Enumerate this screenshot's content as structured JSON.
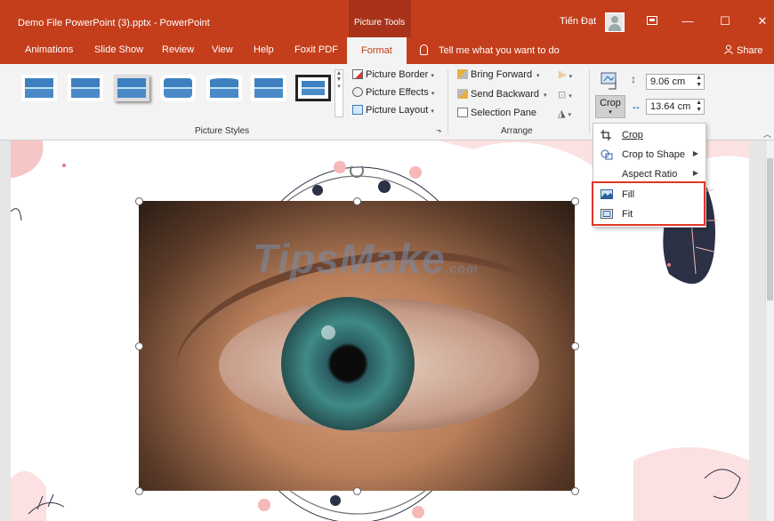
{
  "titlebar": {
    "doc_title": "Demo File PowerPoint (3).pptx  -  PowerPoint",
    "context_tab": "Picture Tools",
    "user_name": "Tiến Đạt",
    "ribbon_options_icon": "ribbon-display-icon",
    "minimize": "—",
    "maximize": "☐",
    "close": "✕"
  },
  "tabs": {
    "items": [
      "Animations",
      "Slide Show",
      "Review",
      "View",
      "Help",
      "Foxit PDF",
      "Format"
    ],
    "active": "Format",
    "tell_me": "Tell me what you want to do",
    "share": "Share"
  },
  "ribbon": {
    "picture_styles": {
      "label": "Picture Styles",
      "picture_border": "Picture Border",
      "picture_effects": "Picture Effects",
      "picture_layout": "Picture Layout"
    },
    "arrange": {
      "label": "Arrange",
      "bring_forward": "Bring Forward",
      "send_backward": "Send Backward",
      "selection_pane": "Selection Pane"
    },
    "size": {
      "height": "9.06 cm",
      "width": "13.64 cm",
      "crop": "Crop"
    }
  },
  "crop_menu": {
    "items": [
      {
        "label": "Crop",
        "icon": "crop-icon",
        "submenu": false
      },
      {
        "label": "Crop to Shape",
        "icon": "crop-to-shape-icon",
        "submenu": true
      },
      {
        "label": "Aspect Ratio",
        "icon": "",
        "submenu": true
      },
      {
        "label": "Fill",
        "icon": "fill-icon",
        "submenu": false
      },
      {
        "label": "Fit",
        "icon": "fit-icon",
        "submenu": false
      }
    ]
  },
  "slide": {
    "watermark": "TipsMake",
    "watermark_suffix": ".com"
  },
  "colors": {
    "accent": "#c43e1c",
    "highlight": "#e0352a",
    "pink_decor": "#f6c6c6",
    "navy_decor": "#2c3145"
  }
}
